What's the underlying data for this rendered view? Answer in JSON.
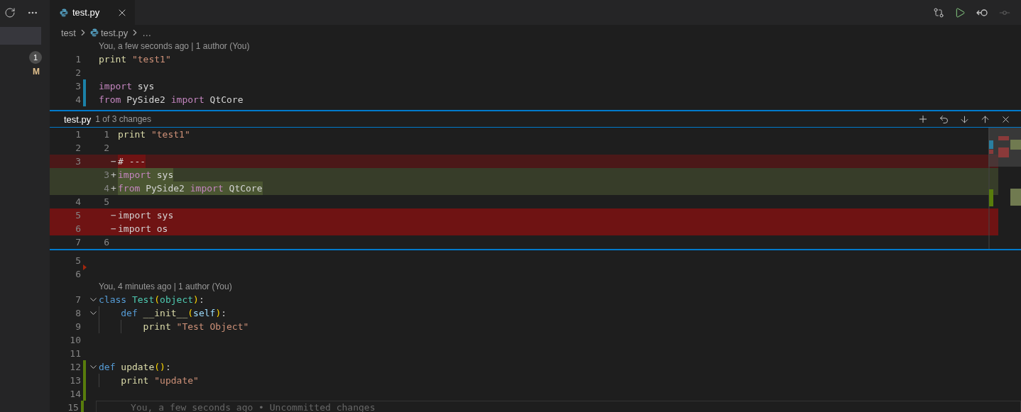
{
  "sidebar": {
    "badge": "1",
    "status_letter": "M",
    "selected_row": true
  },
  "tab": {
    "label": "test.py",
    "selected": true
  },
  "breadcrumb": [
    "test",
    "test.py",
    "…"
  ],
  "top_codelens": "You, a few seconds ago | 1 author (You)",
  "top_lines": [
    {
      "number": "1",
      "kind": "unchanged",
      "foldable": false,
      "tokens": [
        {
          "kind": "builtin",
          "text": "print "
        },
        {
          "kind": "string",
          "text": "\"test1\""
        }
      ]
    },
    {
      "number": "2",
      "kind": "unchanged",
      "foldable": false
    },
    {
      "number": "3",
      "kind": "modified",
      "foldable": false,
      "tokens": [
        {
          "kind": "keyword",
          "text": "import "
        },
        {
          "kind": "plain",
          "text": "sys"
        }
      ]
    },
    {
      "number": "4",
      "kind": "modified",
      "foldable": false,
      "tokens": [
        {
          "kind": "keyword",
          "text": "from "
        },
        {
          "kind": "plain",
          "text": "PySide2 "
        },
        {
          "kind": "keyword",
          "text": "import "
        },
        {
          "kind": "plain",
          "text": "QtCore"
        }
      ]
    }
  ],
  "peek": {
    "file": "test.py",
    "position": "1 of 3 changes",
    "rows": [
      {
        "original": "1",
        "modified": "1",
        "kind": "same",
        "tokens": [
          {
            "kind": "builtin",
            "text": "print "
          },
          {
            "kind": "string",
            "text": "\"test1\""
          }
        ]
      },
      {
        "original": "2",
        "modified": "2",
        "kind": "same"
      },
      {
        "original": "3",
        "sign": "−",
        "kind": "removed",
        "whole_line": false,
        "tokens": [
          {
            "kind": "plain",
            "text": "# ---"
          }
        ]
      },
      {
        "modified": "3",
        "sign": "+",
        "kind": "added",
        "whole_line": false,
        "tokens": [
          {
            "kind": "keyword",
            "text": "import "
          },
          {
            "kind": "plain",
            "text": "sys"
          }
        ]
      },
      {
        "modified": "4",
        "sign": "+",
        "kind": "added",
        "whole_line": false,
        "tokens": [
          {
            "kind": "keyword",
            "text": "from "
          },
          {
            "kind": "plain",
            "text": "PySide2 "
          },
          {
            "kind": "keyword",
            "text": "import "
          },
          {
            "kind": "plain",
            "text": "QtCore"
          }
        ]
      },
      {
        "original": "4",
        "modified": "5",
        "kind": "same"
      },
      {
        "original": "5",
        "sign": "−",
        "kind": "removed",
        "whole_line": true,
        "tokens": [
          {
            "kind": "plain",
            "text": "import sys"
          }
        ]
      },
      {
        "original": "6",
        "sign": "−",
        "kind": "removed",
        "whole_line": true,
        "tokens": [
          {
            "kind": "plain",
            "text": "import os"
          }
        ]
      },
      {
        "original": "7",
        "modified": "6",
        "kind": "same"
      }
    ]
  },
  "bottom_lines": [
    {
      "number": "5",
      "kind": "deleted",
      "foldable": false
    },
    {
      "number": "6",
      "kind": "unchanged",
      "foldable": false
    },
    {
      "kind": "codelens",
      "codelens": "You, 4 minutes ago | 1 author (You)"
    },
    {
      "number": "7",
      "kind": "unchanged",
      "foldable": true,
      "tokens": [
        {
          "kind": "storage",
          "text": "class "
        },
        {
          "kind": "type",
          "text": "Test"
        },
        {
          "kind": "paren",
          "text": "("
        },
        {
          "kind": "type",
          "text": "object"
        },
        {
          "kind": "paren",
          "text": ")"
        },
        {
          "kind": "plain",
          "text": ":"
        }
      ]
    },
    {
      "number": "8",
      "kind": "unchanged",
      "foldable": true,
      "tokens": [
        {
          "kind": "storage",
          "text": "    def "
        },
        {
          "kind": "function",
          "text": "__init__"
        },
        {
          "kind": "paren",
          "text": "("
        },
        {
          "kind": "param",
          "text": "self"
        },
        {
          "kind": "paren",
          "text": ")"
        },
        {
          "kind": "plain",
          "text": ":"
        }
      ]
    },
    {
      "number": "9",
      "kind": "unchanged",
      "foldable": false,
      "tokens": [
        {
          "kind": "builtin",
          "text": "        print "
        },
        {
          "kind": "string",
          "text": "\"Test Object\""
        }
      ]
    },
    {
      "number": "10",
      "kind": "unchanged",
      "foldable": false
    },
    {
      "number": "11",
      "kind": "unchanged",
      "foldable": false
    },
    {
      "number": "12",
      "kind": "added",
      "foldable": true,
      "tokens": [
        {
          "kind": "storage",
          "text": "def "
        },
        {
          "kind": "function",
          "text": "update"
        },
        {
          "kind": "paren",
          "text": "()"
        },
        {
          "kind": "plain",
          "text": ":"
        }
      ]
    },
    {
      "number": "13",
      "kind": "added",
      "foldable": false,
      "tokens": [
        {
          "kind": "builtin",
          "text": "    print "
        },
        {
          "kind": "string",
          "text": "\"update\""
        }
      ]
    },
    {
      "number": "14",
      "kind": "added",
      "foldable": false
    },
    {
      "number": "15",
      "kind": "added",
      "foldable": false,
      "blame": "You, a few seconds ago • Uncommitted changes"
    }
  ]
}
